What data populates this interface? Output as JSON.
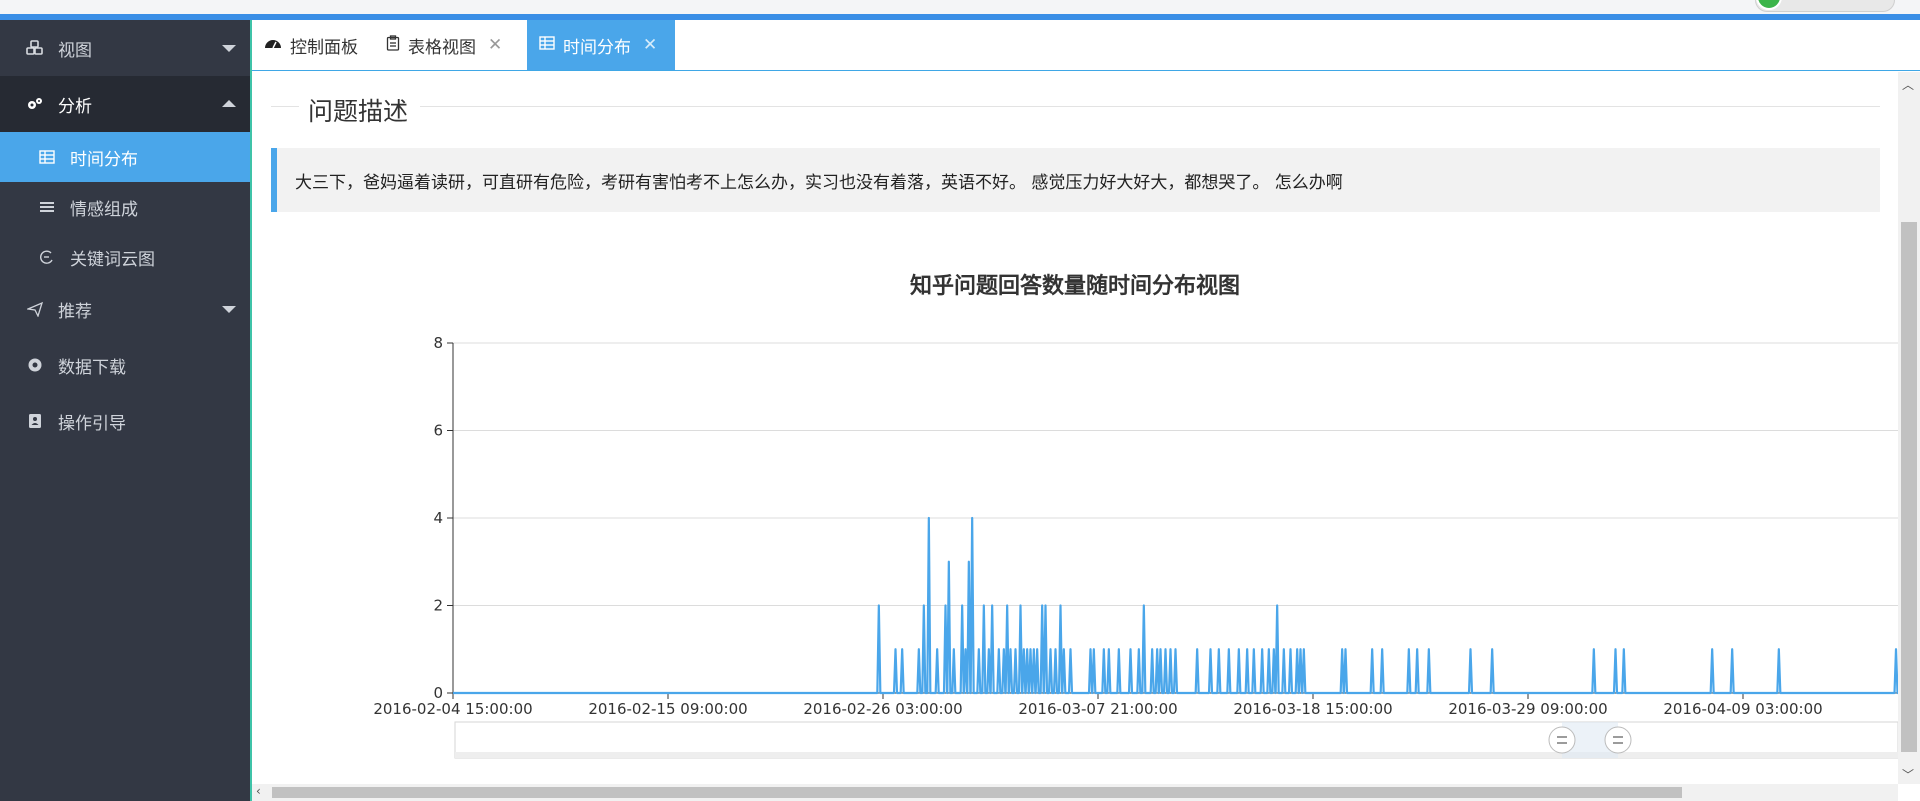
{
  "sidebar": {
    "items": [
      {
        "label": "视图",
        "icon": "cubes-icon"
      },
      {
        "label": "分析",
        "icon": "gears-icon"
      },
      {
        "label": "推荐",
        "icon": "send-icon"
      },
      {
        "label": "数据下载",
        "icon": "record-icon"
      },
      {
        "label": "操作引导",
        "icon": "contact-book-icon"
      }
    ],
    "sub_items": [
      {
        "label": "时间分布",
        "icon": "table-icon"
      },
      {
        "label": "情感组成",
        "icon": "bars-icon"
      },
      {
        "label": "关键词云图",
        "icon": "cloud-icon"
      }
    ]
  },
  "tabs": [
    {
      "label": "控制面板",
      "icon": "dashboard-icon"
    },
    {
      "label": "表格视图",
      "icon": "clipboard-icon"
    },
    {
      "label": "时间分布",
      "icon": "table-icon"
    }
  ],
  "section": {
    "title": "问题描述",
    "description": "大三下，爸妈逼着读研，可直研有危险，考研有害怕考不上怎么办，实习也没有着落，英语不好。 感觉压力好大好大，都想哭了。 怎么办啊"
  },
  "chart_data": {
    "type": "line",
    "title": "知乎问题回答数量随时间分布视图",
    "xlabel": "",
    "ylabel": "",
    "ylim": [
      0,
      8
    ],
    "yticks": [
      0,
      2,
      4,
      6,
      8
    ],
    "xticks": [
      "2016-02-04 15:00:00",
      "2016-02-15 09:00:00",
      "2016-02-26 03:00:00",
      "2016-03-07 21:00:00",
      "2016-03-18 15:00:00",
      "2016-03-29 09:00:00",
      "2016-04-09 03:00:00"
    ],
    "xlim_hours_range": [
      "2016-02-04 15:00:00",
      "2016-04-16 07:00:00"
    ],
    "grid": true,
    "color": "#4aa6ea",
    "spikes": [
      {
        "t": "2016-02-25 22:00",
        "y": 2
      },
      {
        "t": "2016-02-26 18:00",
        "y": 1
      },
      {
        "t": "2016-02-27 02:00",
        "y": 1
      },
      {
        "t": "2016-02-27 22:00",
        "y": 1
      },
      {
        "t": "2016-02-28 04:00",
        "y": 2
      },
      {
        "t": "2016-02-28 10:00",
        "y": 4
      },
      {
        "t": "2016-02-28 20:00",
        "y": 1
      },
      {
        "t": "2016-02-29 06:00",
        "y": 2
      },
      {
        "t": "2016-02-29 10:00",
        "y": 3
      },
      {
        "t": "2016-02-29 16:00",
        "y": 1
      },
      {
        "t": "2016-03-01 02:00",
        "y": 2
      },
      {
        "t": "2016-03-01 06:00",
        "y": 1
      },
      {
        "t": "2016-03-01 10:00",
        "y": 3
      },
      {
        "t": "2016-03-01 14:00",
        "y": 4
      },
      {
        "t": "2016-03-01 22:00",
        "y": 1
      },
      {
        "t": "2016-03-02 04:00",
        "y": 2
      },
      {
        "t": "2016-03-02 10:00",
        "y": 1
      },
      {
        "t": "2016-03-02 14:00",
        "y": 2
      },
      {
        "t": "2016-03-02 22:00",
        "y": 1
      },
      {
        "t": "2016-03-03 04:00",
        "y": 1
      },
      {
        "t": "2016-03-03 08:00",
        "y": 2
      },
      {
        "t": "2016-03-03 12:00",
        "y": 1
      },
      {
        "t": "2016-03-03 18:00",
        "y": 1
      },
      {
        "t": "2016-03-04 00:00",
        "y": 2
      },
      {
        "t": "2016-03-04 04:00",
        "y": 1
      },
      {
        "t": "2016-03-04 08:00",
        "y": 1
      },
      {
        "t": "2016-03-04 12:00",
        "y": 1
      },
      {
        "t": "2016-03-04 16:00",
        "y": 1
      },
      {
        "t": "2016-03-04 20:00",
        "y": 1
      },
      {
        "t": "2016-03-05 02:00",
        "y": 2
      },
      {
        "t": "2016-03-05 06:00",
        "y": 2
      },
      {
        "t": "2016-03-05 12:00",
        "y": 1
      },
      {
        "t": "2016-03-05 18:00",
        "y": 1
      },
      {
        "t": "2016-03-06 00:00",
        "y": 2
      },
      {
        "t": "2016-03-06 04:00",
        "y": 1
      },
      {
        "t": "2016-03-06 12:00",
        "y": 1
      },
      {
        "t": "2016-03-07 12:00",
        "y": 1
      },
      {
        "t": "2016-03-07 16:00",
        "y": 1
      },
      {
        "t": "2016-03-08 04:00",
        "y": 1
      },
      {
        "t": "2016-03-08 10:00",
        "y": 1
      },
      {
        "t": "2016-03-08 22:00",
        "y": 1
      },
      {
        "t": "2016-03-09 12:00",
        "y": 1
      },
      {
        "t": "2016-03-09 22:00",
        "y": 1
      },
      {
        "t": "2016-03-10 04:00",
        "y": 2
      },
      {
        "t": "2016-03-10 14:00",
        "y": 1
      },
      {
        "t": "2016-03-10 20:00",
        "y": 1
      },
      {
        "t": "2016-03-11 00:00",
        "y": 1
      },
      {
        "t": "2016-03-11 06:00",
        "y": 1
      },
      {
        "t": "2016-03-11 12:00",
        "y": 1
      },
      {
        "t": "2016-03-11 18:00",
        "y": 1
      },
      {
        "t": "2016-03-12 20:00",
        "y": 1
      },
      {
        "t": "2016-03-13 12:00",
        "y": 1
      },
      {
        "t": "2016-03-13 22:00",
        "y": 1
      },
      {
        "t": "2016-03-14 10:00",
        "y": 1
      },
      {
        "t": "2016-03-14 22:00",
        "y": 1
      },
      {
        "t": "2016-03-15 08:00",
        "y": 1
      },
      {
        "t": "2016-03-15 16:00",
        "y": 1
      },
      {
        "t": "2016-03-16 02:00",
        "y": 1
      },
      {
        "t": "2016-03-16 10:00",
        "y": 1
      },
      {
        "t": "2016-03-16 16:00",
        "y": 1
      },
      {
        "t": "2016-03-16 20:00",
        "y": 2
      },
      {
        "t": "2016-03-17 04:00",
        "y": 1
      },
      {
        "t": "2016-03-17 12:00",
        "y": 1
      },
      {
        "t": "2016-03-17 20:00",
        "y": 1
      },
      {
        "t": "2016-03-18 00:00",
        "y": 1
      },
      {
        "t": "2016-03-18 04:00",
        "y": 1
      },
      {
        "t": "2016-03-20 02:00",
        "y": 1
      },
      {
        "t": "2016-03-20 06:00",
        "y": 1
      },
      {
        "t": "2016-03-21 14:00",
        "y": 1
      },
      {
        "t": "2016-03-22 02:00",
        "y": 1
      },
      {
        "t": "2016-03-23 10:00",
        "y": 1
      },
      {
        "t": "2016-03-23 20:00",
        "y": 1
      },
      {
        "t": "2016-03-24 10:00",
        "y": 1
      },
      {
        "t": "2016-03-26 12:00",
        "y": 1
      },
      {
        "t": "2016-03-27 14:00",
        "y": 1
      },
      {
        "t": "2016-04-01 16:00",
        "y": 1
      },
      {
        "t": "2016-04-02 18:00",
        "y": 1
      },
      {
        "t": "2016-04-03 04:00",
        "y": 1
      },
      {
        "t": "2016-04-07 14:00",
        "y": 1
      },
      {
        "t": "2016-04-08 14:00",
        "y": 1
      },
      {
        "t": "2016-04-10 22:00",
        "y": 1
      },
      {
        "t": "2016-04-17 12:00",
        "y": 1
      }
    ]
  }
}
